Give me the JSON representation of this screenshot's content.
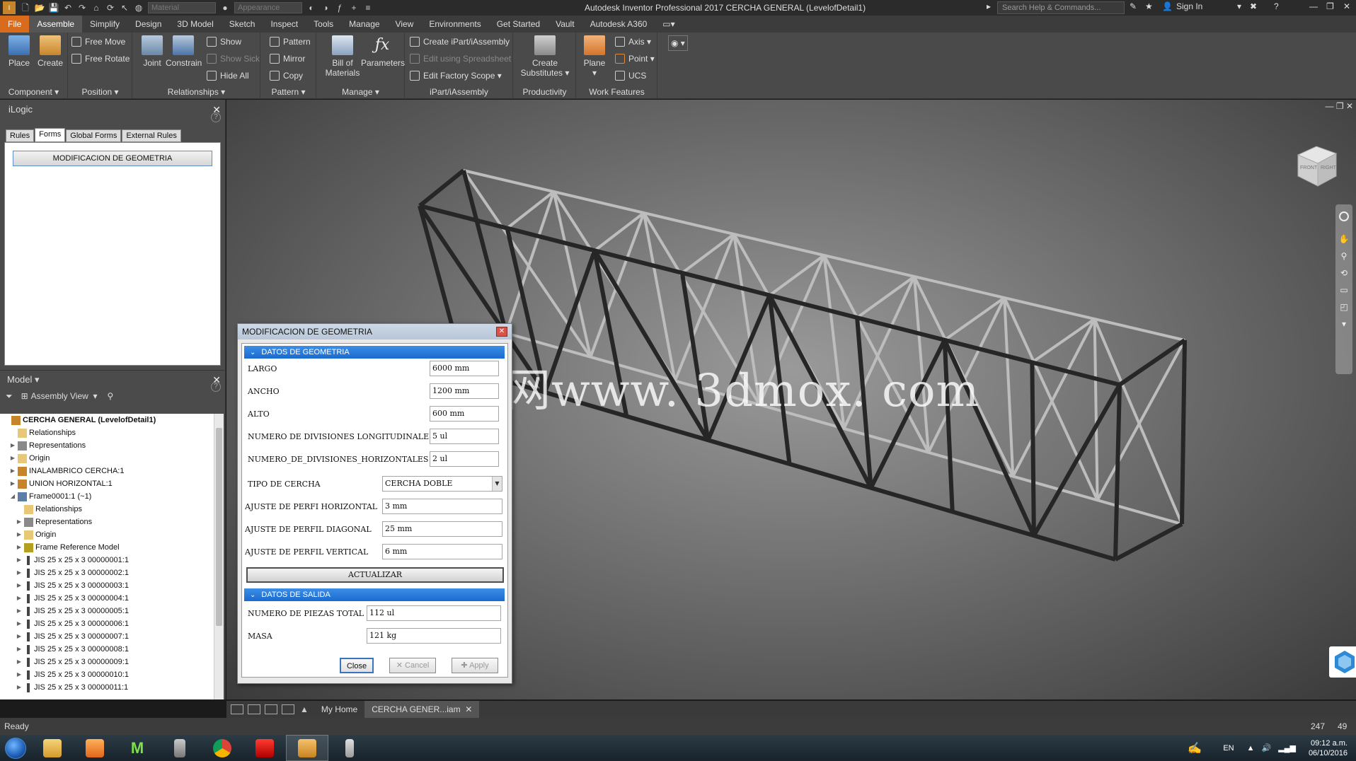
{
  "titlebar": {
    "title": "Autodesk Inventor Professional 2017    CERCHA GENERAL (LevelofDetail1)",
    "material_placeholder": "Material",
    "appearance_placeholder": "Appearance",
    "search_placeholder": "Search Help & Commands...",
    "sign_in": "Sign In"
  },
  "menu": {
    "file": "File",
    "tabs": [
      "Assemble",
      "Simplify",
      "Design",
      "3D Model",
      "Sketch",
      "Inspect",
      "Tools",
      "Manage",
      "View",
      "Environments",
      "Get Started",
      "Vault",
      "Autodesk A360"
    ],
    "active": "Assemble"
  },
  "ribbon": {
    "component": {
      "title": "Component",
      "place": "Place",
      "create": "Create"
    },
    "position": {
      "title": "Position",
      "free_move": "Free Move",
      "free_rotate": "Free Rotate"
    },
    "relationships": {
      "title": "Relationships",
      "joint": "Joint",
      "constrain": "Constrain",
      "show": "Show",
      "show_sick": "Show Sick",
      "hide_all": "Hide All"
    },
    "pattern": {
      "title": "Pattern",
      "pattern": "Pattern",
      "mirror": "Mirror",
      "copy": "Copy"
    },
    "manage": {
      "title": "Manage",
      "bom_line1": "Bill of",
      "bom_line2": "Materials",
      "parameters": "Parameters"
    },
    "ipart": {
      "title": "iPart/iAssembly",
      "create": "Create iPart/iAssembly",
      "edit_spreadsheet": "Edit using Spreadsheet",
      "edit_factory": "Edit Factory Scope"
    },
    "productivity": {
      "title": "Productivity",
      "line1": "Create",
      "line2": "Substitutes"
    },
    "work_features": {
      "title": "Work Features",
      "plane": "Plane",
      "axis": "Axis",
      "point": "Point",
      "ucs": "UCS"
    }
  },
  "ilogic": {
    "title": "iLogic",
    "tabs": [
      "Rules",
      "Forms",
      "Global Forms",
      "External Rules"
    ],
    "active_tab": "Forms",
    "form_button": "MODIFICACION DE GEOMETRIA"
  },
  "model": {
    "title": "Model",
    "view": "Assembly View",
    "tree": [
      {
        "label": "CERCHA GENERAL (LevelofDetail1)",
        "indent": 0,
        "exp": "",
        "icon": "assembly-icon",
        "root": true
      },
      {
        "label": "Relationships",
        "indent": 1,
        "exp": "",
        "icon": "folder-icon"
      },
      {
        "label": "Representations",
        "indent": 1,
        "exp": "▶",
        "icon": "representations-icon"
      },
      {
        "label": "Origin",
        "indent": 1,
        "exp": "▶",
        "icon": "folder-icon"
      },
      {
        "label": "INALAMBRICO CERCHA:1",
        "indent": 1,
        "exp": "▶",
        "icon": "subassembly-icon"
      },
      {
        "label": "UNION HORIZONTAL:1",
        "indent": 1,
        "exp": "▶",
        "icon": "subassembly-icon"
      },
      {
        "label": "Frame0001:1 (~1)",
        "indent": 1,
        "exp": "◢",
        "icon": "frame-icon"
      },
      {
        "label": "Relationships",
        "indent": 2,
        "exp": "",
        "icon": "folder-icon"
      },
      {
        "label": "Representations",
        "indent": 2,
        "exp": "▶",
        "icon": "representations-icon"
      },
      {
        "label": "Origin",
        "indent": 2,
        "exp": "▶",
        "icon": "folder-icon"
      },
      {
        "label": "Frame Reference Model",
        "indent": 2,
        "exp": "▶",
        "icon": "reference-model-icon"
      },
      {
        "label": "JIS 25 x 25 x 3 00000001:1",
        "indent": 2,
        "exp": "▶",
        "icon": "profile-icon"
      },
      {
        "label": "JIS 25 x 25 x 3 00000002:1",
        "indent": 2,
        "exp": "▶",
        "icon": "profile-icon"
      },
      {
        "label": "JIS 25 x 25 x 3 00000003:1",
        "indent": 2,
        "exp": "▶",
        "icon": "profile-icon"
      },
      {
        "label": "JIS 25 x 25 x 3 00000004:1",
        "indent": 2,
        "exp": "▶",
        "icon": "profile-icon"
      },
      {
        "label": "JIS 25 x 25 x 3 00000005:1",
        "indent": 2,
        "exp": "▶",
        "icon": "profile-icon"
      },
      {
        "label": "JIS 25 x 25 x 3 00000006:1",
        "indent": 2,
        "exp": "▶",
        "icon": "profile-icon"
      },
      {
        "label": "JIS 25 x 25 x 3 00000007:1",
        "indent": 2,
        "exp": "▶",
        "icon": "profile-icon"
      },
      {
        "label": "JIS 25 x 25 x 3 00000008:1",
        "indent": 2,
        "exp": "▶",
        "icon": "profile-icon"
      },
      {
        "label": "JIS 25 x 25 x 3 00000009:1",
        "indent": 2,
        "exp": "▶",
        "icon": "profile-icon"
      },
      {
        "label": "JIS 25 x 25 x 3 00000010:1",
        "indent": 2,
        "exp": "▶",
        "icon": "profile-icon"
      },
      {
        "label": "JIS 25 x 25 x 3 00000011:1",
        "indent": 2,
        "exp": "▶",
        "icon": "profile-icon"
      }
    ]
  },
  "viewport": {
    "watermark": "莫西网www. 3dmox. com",
    "viewcube_front": "FRONT",
    "viewcube_right": "RIGHT"
  },
  "dialog": {
    "title": "MODIFICACION DE GEOMETRIA",
    "section1": "DATOS DE GEOMETRIA",
    "fields": {
      "largo_label": "LARGO",
      "largo_value": "6000 mm",
      "ancho_label": "ANCHO",
      "ancho_value": "1200 mm",
      "alto_label": "ALTO",
      "alto_value": "600 mm",
      "div_long_label": "NUMERO DE DIVISIONES LONGITUDINALES",
      "div_long_value": "5 ul",
      "div_hor_label": "NUMERO_DE_DIVISIONES_HORIZONTALES",
      "div_hor_value": "2 ul",
      "tipo_label": "TIPO DE CERCHA",
      "tipo_value": "CERCHA DOBLE",
      "aj_hor_label": "AJUSTE DE PERFI  HORIZONTAL",
      "aj_hor_value": "3 mm",
      "aj_diag_label": "AJUSTE DE PERFIL DIAGONAL",
      "aj_diag_value": "25 mm",
      "aj_vert_label": "AJUSTE DE PERFIL VERTICAL",
      "aj_vert_value": "6 mm"
    },
    "update_button": "ACTUALIZAR",
    "section2": "DATOS DE SALIDA",
    "output": {
      "piezas_label": "NUMERO DE PIEZAS TOTAL",
      "piezas_value": "112 ul",
      "masa_label": "MASA",
      "masa_value": "121 kg"
    },
    "buttons": {
      "close": "Close",
      "cancel": "Cancel",
      "apply": "Apply"
    }
  },
  "doc_tabs": {
    "home": "My Home",
    "doc": "CERCHA GENER...iam"
  },
  "status": {
    "text": "Ready",
    "n1": "247",
    "n2": "49"
  },
  "tray": {
    "lang": "EN",
    "time": "09:12 a.m.",
    "date": "06/10/2016"
  },
  "colors": {
    "file_tab": "#d86c1c",
    "section_blue": "#1a6ad0",
    "panel_bg": "#4b4b4b"
  }
}
